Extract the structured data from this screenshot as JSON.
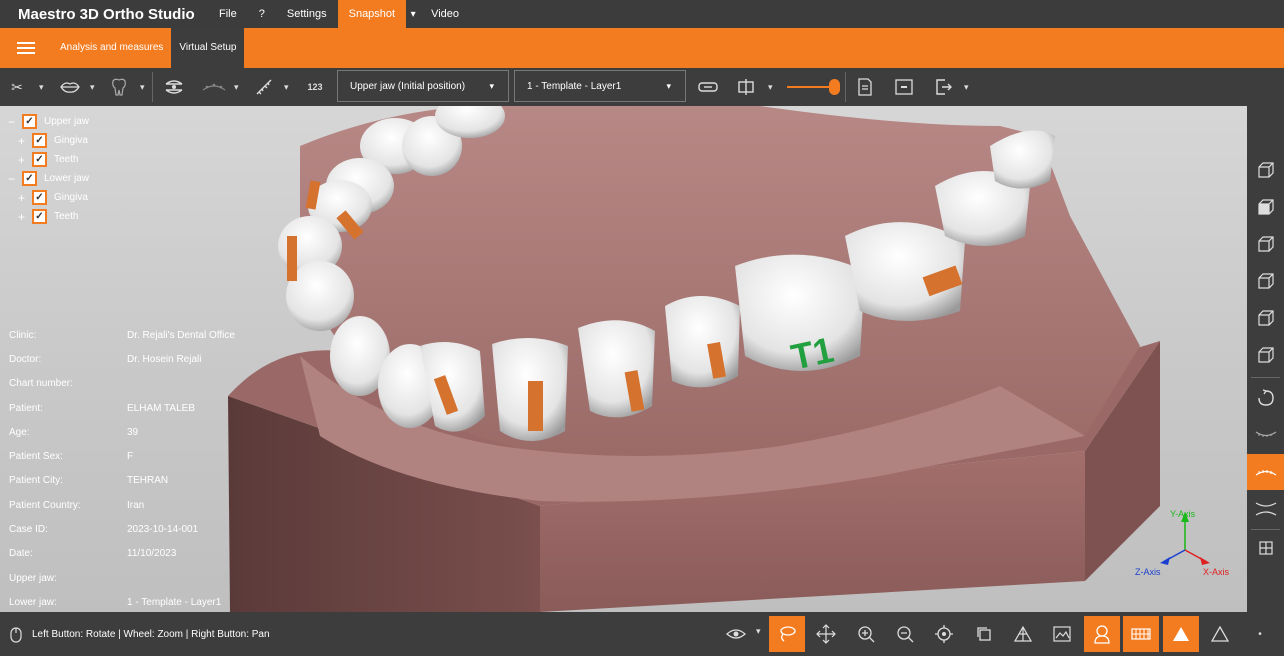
{
  "app": {
    "title": "Maestro 3D Ortho Studio"
  },
  "menu": {
    "file": "File",
    "help": "?",
    "settings": "Settings",
    "snapshot": "Snapshot",
    "video": "Video"
  },
  "ribbon": {
    "tab_analysis": "Analysis and measures",
    "tab_virtual_setup": "Virtual Setup",
    "active_tab": "Virtual Setup"
  },
  "toolbar": {
    "numbering_label": "123",
    "jaw_select": "Upper jaw (Initial position)",
    "template_select": "1 - Template - Layer1",
    "opacity_percent": 100
  },
  "tree": {
    "upper_jaw": "Upper jaw",
    "upper_gingiva": "Gingiva",
    "upper_teeth": "Teeth",
    "lower_jaw": "Lower jaw",
    "lower_gingiva": "Gingiva",
    "lower_teeth": "Teeth"
  },
  "patient_info": [
    {
      "label": "Clinic:",
      "value": "Dr. Rejali's Dental Office"
    },
    {
      "label": "Doctor:",
      "value": "Dr. Hosein Rejali"
    },
    {
      "label": "Chart number:",
      "value": ""
    },
    {
      "label": "Patient:",
      "value": "ELHAM TALEB"
    },
    {
      "label": "Age:",
      "value": "39"
    },
    {
      "label": "Patient Sex:",
      "value": "F"
    },
    {
      "label": "Patient City:",
      "value": "TEHRAN"
    },
    {
      "label": "Patient Country:",
      "value": "Iran"
    },
    {
      "label": "Case  ID:",
      "value": "2023-10-14-001"
    },
    {
      "label": "Date:",
      "value": "11/10/2023"
    },
    {
      "label": "Upper jaw:",
      "value": ""
    },
    {
      "label": "Lower jaw:",
      "value": "1 - Template - Layer1"
    }
  ],
  "viewport": {
    "tooth_label": "T1"
  },
  "axes": {
    "x": "X-Axis",
    "y": "Y-Axis",
    "z": "Z-Axis"
  },
  "status": {
    "hint": "Left Button: Rotate | Wheel: Zoom | Right Button: Pan"
  },
  "colors": {
    "accent": "#f47c20",
    "background": "#3d3d3d",
    "gingiva": "#9e6e6c",
    "model_base": "#8c5e5c",
    "bracket": "#d4722e",
    "tooth_label": "#22a040"
  }
}
